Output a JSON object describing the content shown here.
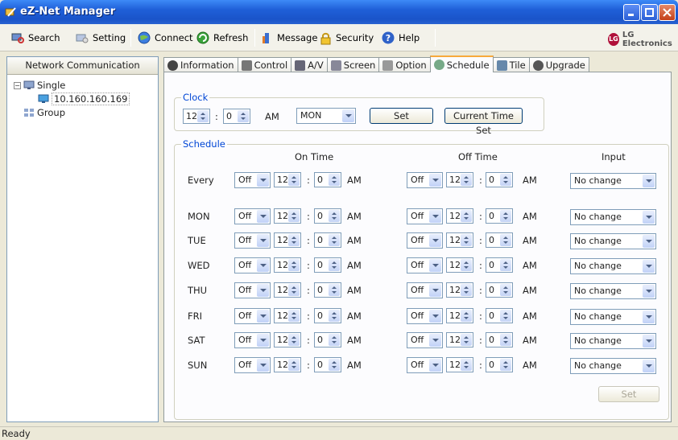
{
  "window": {
    "title": "eZ-Net Manager"
  },
  "toolbar": {
    "search": "Search",
    "setting": "Setting",
    "connect": "Connect",
    "refresh": "Refresh",
    "message": "Message",
    "security": "Security",
    "help": "Help",
    "brand": "LG Electronics"
  },
  "left": {
    "header": "Network Communication",
    "single": "Single",
    "device": "10.160.160.169",
    "group": "Group"
  },
  "tabs": [
    "Information",
    "Control",
    "A/V",
    "Screen",
    "Option",
    "Schedule",
    "Tile",
    "Upgrade"
  ],
  "active_tab": "Schedule",
  "clock": {
    "label": "Clock",
    "hour": "12",
    "minute": "0",
    "ampm": "AM",
    "day": "MON",
    "set": "Set",
    "current": "Current Time Set"
  },
  "schedule": {
    "label": "Schedule",
    "on_time": "On Time",
    "off_time": "Off Time",
    "input": "Input",
    "apply": "Set",
    "rows": [
      {
        "day": "Every",
        "on_state": "Off",
        "on_hour": "12",
        "on_min": "0",
        "on_ampm": "AM",
        "off_state": "Off",
        "off_hour": "12",
        "off_min": "0",
        "off_ampm": "AM",
        "input": "No change"
      },
      {
        "day": "MON",
        "on_state": "Off",
        "on_hour": "12",
        "on_min": "0",
        "on_ampm": "AM",
        "off_state": "Off",
        "off_hour": "12",
        "off_min": "0",
        "off_ampm": "AM",
        "input": "No change"
      },
      {
        "day": "TUE",
        "on_state": "Off",
        "on_hour": "12",
        "on_min": "0",
        "on_ampm": "AM",
        "off_state": "Off",
        "off_hour": "12",
        "off_min": "0",
        "off_ampm": "AM",
        "input": "No change"
      },
      {
        "day": "WED",
        "on_state": "Off",
        "on_hour": "12",
        "on_min": "0",
        "on_ampm": "AM",
        "off_state": "Off",
        "off_hour": "12",
        "off_min": "0",
        "off_ampm": "AM",
        "input": "No change"
      },
      {
        "day": "THU",
        "on_state": "Off",
        "on_hour": "12",
        "on_min": "0",
        "on_ampm": "AM",
        "off_state": "Off",
        "off_hour": "12",
        "off_min": "0",
        "off_ampm": "AM",
        "input": "No change"
      },
      {
        "day": "FRI",
        "on_state": "Off",
        "on_hour": "12",
        "on_min": "0",
        "on_ampm": "AM",
        "off_state": "Off",
        "off_hour": "12",
        "off_min": "0",
        "off_ampm": "AM",
        "input": "No change"
      },
      {
        "day": "SAT",
        "on_state": "Off",
        "on_hour": "12",
        "on_min": "0",
        "on_ampm": "AM",
        "off_state": "Off",
        "off_hour": "12",
        "off_min": "0",
        "off_ampm": "AM",
        "input": "No change"
      },
      {
        "day": "SUN",
        "on_state": "Off",
        "on_hour": "12",
        "on_min": "0",
        "on_ampm": "AM",
        "off_state": "Off",
        "off_hour": "12",
        "off_min": "0",
        "off_ampm": "AM",
        "input": "No change"
      }
    ]
  },
  "status": "Ready"
}
